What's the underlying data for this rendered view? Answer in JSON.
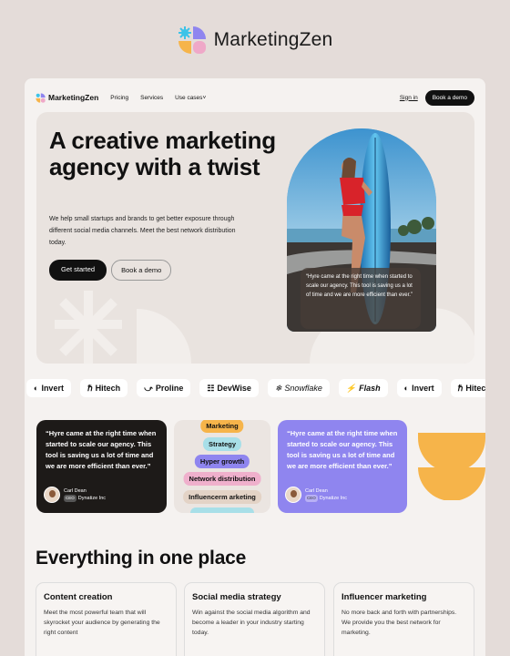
{
  "brand": {
    "name": "MarketingZen"
  },
  "nav": {
    "logo": "MarketingZen",
    "links": [
      "Pricing",
      "Services",
      "Use cases"
    ],
    "signin": "Sign in",
    "demo": "Book a demo"
  },
  "hero": {
    "headline": "A creative marketing agency with a twist",
    "subtext": "We help small startups and brands to get better exposure through different social media channels. Meet the best network distribution today.",
    "primary_cta": "Get started",
    "secondary_cta": "Book a demo",
    "quote": "“Hyre came at the right time when started to scale our agency. This tool is saving us a lot of time and we are more efficient than ever.”"
  },
  "logos": [
    "Invert",
    "Hitech",
    "Proline",
    "DevWise",
    "Snowflake",
    "Flash",
    "Invert",
    "Hitech"
  ],
  "testimonial_dark": {
    "quote": "“Hyre came at the right time when started to scale our agency. This tool is saving us a lot of time and we are more efficient than ever.”",
    "name": "Carl Dean",
    "role": "CEO",
    "company": "Dynatize Inc"
  },
  "tags": [
    {
      "label": "Marketing",
      "color": "#f6b44a"
    },
    {
      "label": "Strategy",
      "color": "#a8dfe8"
    },
    {
      "label": "Hyper growth",
      "color": "#8f85ef"
    },
    {
      "label": "Network distribution",
      "color": "#efb0cc"
    },
    {
      "label": "Influencerm arketing",
      "color": "#e3d3c6"
    }
  ],
  "testimonial_purple": {
    "quote": "“Hyre came at the right time when started to scale our agency. This tool is saving us a lot of time and we are more efficient than ever.”",
    "name": "Carl Dean",
    "role": "CEO",
    "company": "Dynatize Inc"
  },
  "section": {
    "title": "Everything in one place"
  },
  "features": [
    {
      "title": "Content creation",
      "text": "Meet the most powerful team that will skyrocket your audience by generating the right content"
    },
    {
      "title": "Social media strategy",
      "text": "Win against the social media algorithm and become a leader in your industry starting today."
    },
    {
      "title": "Influencer marketing",
      "text": "No more back and forth with partnerships. We provide you the best network for marketing."
    }
  ],
  "colors": {
    "accent_orange": "#f6b44a",
    "accent_purple": "#8f85ef",
    "dark": "#111111"
  }
}
